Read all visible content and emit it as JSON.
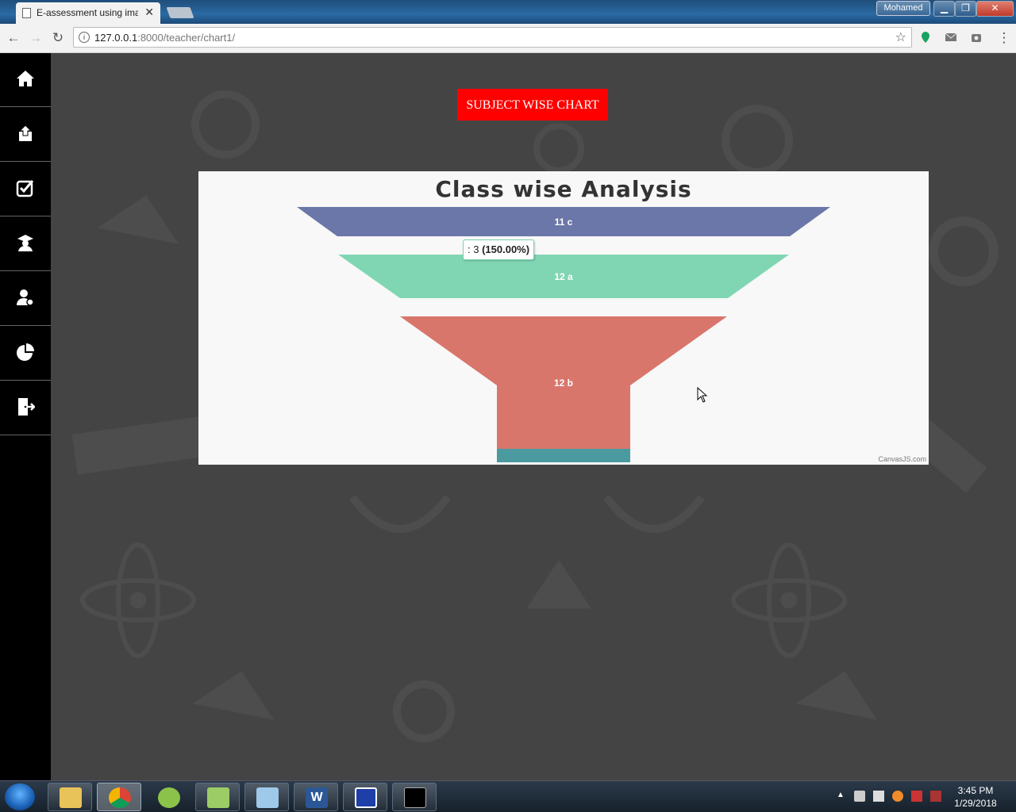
{
  "browser": {
    "tab_title": "E-assessment using imag",
    "url_host": "127.0.0.1",
    "url_rest": ":8000/teacher/chart1/",
    "user_name": "Mohamed",
    "close_glyph": "✕"
  },
  "sidebar": {
    "items": [
      {
        "icon": "home-icon"
      },
      {
        "icon": "upload-icon"
      },
      {
        "icon": "checkbox-icon"
      },
      {
        "icon": "student-icon"
      },
      {
        "icon": "user-settings-icon"
      },
      {
        "icon": "pie-chart-icon"
      },
      {
        "icon": "logout-icon"
      }
    ]
  },
  "main": {
    "button_label": "SUBJECT WISE CHART",
    "colors": {
      "button": "#ff0000"
    }
  },
  "chart_data": {
    "type": "funnel",
    "title": "Class wise Analysis",
    "categories": [
      "11 c",
      "12 a",
      "12 b",
      ""
    ],
    "colors": [
      "#6b77a8",
      "#80d6b3",
      "#d9766c",
      "#4a9aa0"
    ],
    "tooltip": {
      "prefix": ": 3",
      "percent": "(150.00%)"
    },
    "credit": "CanvasJS.com"
  },
  "taskbar": {
    "apps": [
      "file-explorer-icon",
      "chrome-icon",
      "chameleon-icon",
      "notepad-plus-icon",
      "eraser-icon",
      "word-icon",
      "app-icon",
      "cmd-icon"
    ],
    "time": "3:45 PM",
    "date": "1/29/2018"
  }
}
